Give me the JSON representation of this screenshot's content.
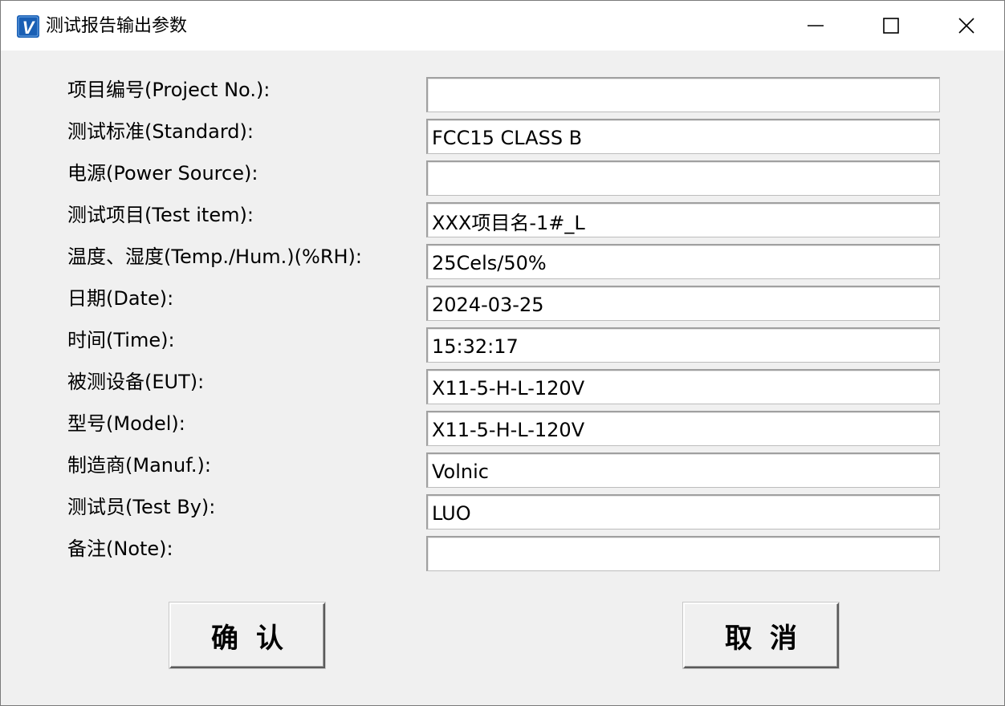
{
  "window": {
    "title": "测试报告输出参数",
    "app_icon_letter": "V",
    "accent_color": "#1a5fb4"
  },
  "fields": [
    {
      "label": "项目编号(Project No.):",
      "value": ""
    },
    {
      "label": "测试标准(Standard):",
      "value": "FCC15 CLASS B"
    },
    {
      "label": "电源(Power Source):",
      "value": ""
    },
    {
      "label": "测试项目(Test item):",
      "value": "XXX项目名-1#_L"
    },
    {
      "label": "温度、湿度(Temp./Hum.)(%RH):",
      "value": "25Cels/50%"
    },
    {
      "label": "日期(Date):",
      "value": "2024-03-25"
    },
    {
      "label": "时间(Time):",
      "value": "15:32:17"
    },
    {
      "label": "被测设备(EUT):",
      "value": "X11-5-H-L-120V"
    },
    {
      "label": "型号(Model):",
      "value": "X11-5-H-L-120V"
    },
    {
      "label": "制造商(Manuf.):",
      "value": "Volnic"
    },
    {
      "label": "测试员(Test By):",
      "value": "LUO"
    },
    {
      "label": "备注(Note):",
      "value": ""
    }
  ],
  "buttons": {
    "ok_label": "确认",
    "cancel_label": "取消"
  }
}
